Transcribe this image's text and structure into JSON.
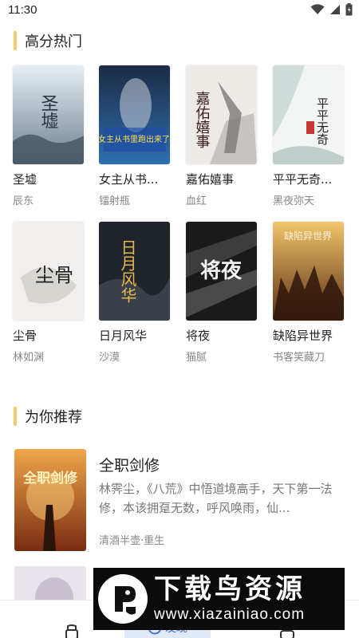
{
  "status_bar": {
    "time": "11:30"
  },
  "sections": {
    "hot": {
      "title": "高分热门"
    },
    "recommend": {
      "title": "为你推荐"
    }
  },
  "hot_books": [
    {
      "title": "圣墟",
      "author": "辰东",
      "cover_text": "圣墟"
    },
    {
      "title": "女主从书...",
      "author": "镭射瓶",
      "cover_text": "女主从书里跑出来了"
    },
    {
      "title": "嘉佑嬉事",
      "author": "血红",
      "cover_text": "嘉佑嬉事"
    },
    {
      "title": "平平无奇...",
      "author": "黑夜弥天",
      "cover_text": "平平无奇"
    },
    {
      "title": "尘骨",
      "author": "林如渊",
      "cover_text": "尘骨"
    },
    {
      "title": "日月风华",
      "author": "沙漠",
      "cover_text": "日月风华"
    },
    {
      "title": "将夜",
      "author": "猫腻",
      "cover_text": "将夜"
    },
    {
      "title": "缺陷异世界",
      "author": "书客笑藏刀",
      "cover_text": "缺陷异世界"
    }
  ],
  "recommendations": [
    {
      "title": "全职剑修",
      "description": "林霁尘，《八荒》中悟道境高手，天下第一法修，本该拥趸无数，呼风唤雨，仙...",
      "meta": "清酒半壶·重生",
      "cover_text": "全职剑修"
    }
  ],
  "bottom_nav": {
    "discover_label": "发现"
  },
  "watermark": {
    "title": "下载鸟资源",
    "url": "www.xiazainiao.com"
  },
  "colors": {
    "accent_bar": "#f5c96a",
    "nav_active": "#3b6fd1"
  }
}
